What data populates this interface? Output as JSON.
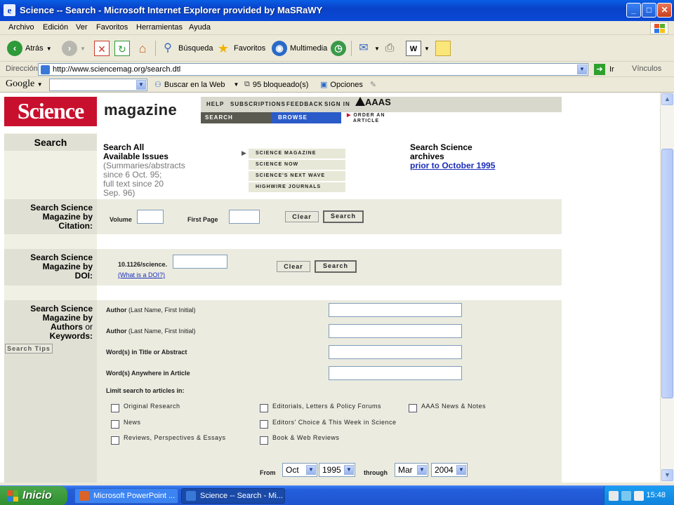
{
  "window": {
    "title": "Science -- Search - Microsoft Internet Explorer provided by MaSRaWY",
    "buttons": {
      "minimize": "_",
      "maximize": "□",
      "close": "✕"
    }
  },
  "menu": [
    "Archivo",
    "Edición",
    "Ver",
    "Favoritos",
    "Herramientas",
    "Ayuda"
  ],
  "toolbar": {
    "back": "Atrás",
    "search": "Búsqueda",
    "favorites": "Favoritos",
    "multimedia": "Multimedia"
  },
  "address": {
    "label": "Dirección",
    "url": "http://www.sciencemag.org/search.dtl",
    "go": "Ir",
    "links": "Vínculos"
  },
  "google": {
    "logo": "Google",
    "search_web": "Buscar en la Web",
    "blocked": "95 bloqueado(s)",
    "options": "Opciones"
  },
  "header": {
    "logo": "Science",
    "magazine": "magazine",
    "nav": [
      "HELP",
      "SUBSCRIPTIONS",
      "FEEDBACK",
      "SIGN IN"
    ],
    "aaas": "AAAS",
    "tab_search": "SEARCH",
    "tab_browse": "BROWSE",
    "order_line1": "ORDER AN",
    "order_line2": "ARTICLE"
  },
  "left_tab": "Search",
  "search_all": {
    "heading1": "Search All",
    "heading2": "Available Issues",
    "desc": [
      "(Summaries/abstracts",
      "since 6 Oct. 95;",
      "full text since 20",
      "Sep. 96)"
    ]
  },
  "publications": [
    "SCIENCE MAGAZINE",
    "SCIENCE NOW",
    "SCIENCE'S NEXT WAVE",
    "HIGHWIRE JOURNALS"
  ],
  "archives": {
    "line1": "Search Science",
    "line2": "archives",
    "link": "prior to October 1995"
  },
  "citation": {
    "label": [
      "Search Science",
      "Magazine by",
      "Citation:"
    ],
    "volume": "Volume",
    "first_page": "First Page",
    "clear": "Clear",
    "search": "Search"
  },
  "doi": {
    "label": [
      "Search Science",
      "Magazine by",
      "DOI:"
    ],
    "prefix": "10.1126/science.",
    "what": "(What is a DOI?)",
    "clear": "Clear",
    "search": "Search"
  },
  "keywords": {
    "label_l1": "Search Science",
    "label_l2": "Magazine by",
    "label_authors": "Authors",
    "label_or": "or",
    "label_kw": "Keywords:",
    "tips": "Search Tips",
    "author1": "Author",
    "author1_hint": "(Last Name, First Initial)",
    "author2": "Author",
    "author2_hint": "(Last Name, First Initial)",
    "title_abstract": "Word(s) in Title or Abstract",
    "anywhere": "Word(s) Anywhere in Article",
    "limit": "Limit search to articles in:",
    "checkboxes": [
      "Original Research",
      "News",
      "Reviews, Perspectives & Essays",
      "Editorials, Letters & Policy Forums",
      "Editors' Choice & This Week in Science",
      "Book & Web Reviews",
      "AAAS News & Notes"
    ],
    "from": "From",
    "from_month": "Oct",
    "from_year": "1995",
    "through": "through",
    "to_month": "Mar",
    "to_year": "2004"
  },
  "taskbar": {
    "start": "Inicio",
    "task1": "Microsoft PowerPoint ...",
    "task2": "Science -- Search - Mi...",
    "clock": "15:48"
  }
}
